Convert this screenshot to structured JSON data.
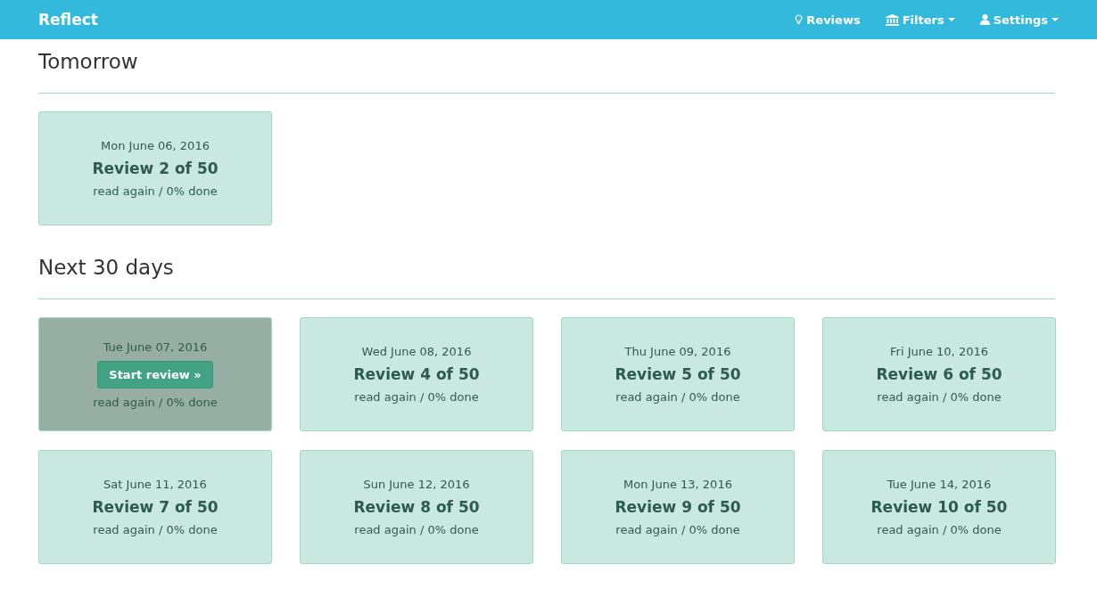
{
  "navbar": {
    "brand": "Reflect",
    "items": [
      {
        "label": "Reviews",
        "dropdown": false
      },
      {
        "label": "Filters",
        "dropdown": true
      },
      {
        "label": "Settings",
        "dropdown": true
      }
    ]
  },
  "sections": [
    {
      "title": "Tomorrow",
      "cards": [
        {
          "date": "Mon June 06, 2016",
          "title": "Review 2 of 50",
          "status": "read again / 0% done",
          "hovered": false
        }
      ]
    },
    {
      "title": "Next 30 days",
      "cards": [
        {
          "date": "Tue June 07, 2016",
          "status": "read again / 0% done",
          "hovered": true,
          "button": "Start review »"
        },
        {
          "date": "Wed June 08, 2016",
          "title": "Review 4 of 50",
          "status": "read again / 0% done",
          "hovered": false
        },
        {
          "date": "Thu June 09, 2016",
          "title": "Review 5 of 50",
          "status": "read again / 0% done",
          "hovered": false
        },
        {
          "date": "Fri June 10, 2016",
          "title": "Review 6 of 50",
          "status": "read again / 0% done",
          "hovered": false
        },
        {
          "date": "Sat June 11, 2016",
          "title": "Review 7 of 50",
          "status": "read again / 0% done",
          "hovered": false
        },
        {
          "date": "Sun June 12, 2016",
          "title": "Review 8 of 50",
          "status": "read again / 0% done",
          "hovered": false
        },
        {
          "date": "Mon June 13, 2016",
          "title": "Review 9 of 50",
          "status": "read again / 0% done",
          "hovered": false
        },
        {
          "date": "Tue June 14, 2016",
          "title": "Review 10 of 50",
          "status": "read again / 0% done",
          "hovered": false
        }
      ]
    }
  ]
}
